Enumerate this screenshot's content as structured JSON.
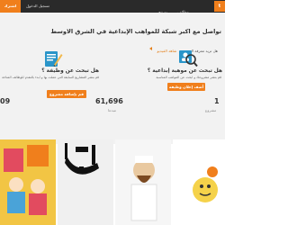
{
  "topbar": {
    "signup_label": "اشترك مجانا",
    "login_label": "تسجيل الدخول",
    "nav": [
      "وظائف",
      "تصفح"
    ],
    "logo_text": "t"
  },
  "hero": {
    "headline": "تواصل مع اكبر شبكة للمواهب الإبداعية في الشرق الاوسط",
    "subline": "هل تريد معرفة المزيد",
    "watch_label": "شاهد الفيديو"
  },
  "left_card": {
    "title": "هل تبحث عن وظيفة ؟",
    "desc": "قم بنشر المشاريع السابقة التي عملت بها و ابدء بالتقدم للوظائف المتاحة",
    "cta": "قم بإضافة مشروع"
  },
  "right_card": {
    "title": "هل تبحث عن موهبة إبداعية ؟",
    "desc": "قم بنشر مشروعك و ابحث عن المواهب المناسبة",
    "cta": "أضف إعلان وظيفة"
  },
  "stats": [
    {
      "value": "09",
      "label": ""
    },
    {
      "value": "61,696",
      "label": "مبدعا"
    },
    {
      "value": "1",
      "label": "مشروع"
    }
  ],
  "colors": {
    "accent": "#f07f1c",
    "topbar": "#2a2a2a",
    "hero_bg": "#f2f2f2"
  }
}
